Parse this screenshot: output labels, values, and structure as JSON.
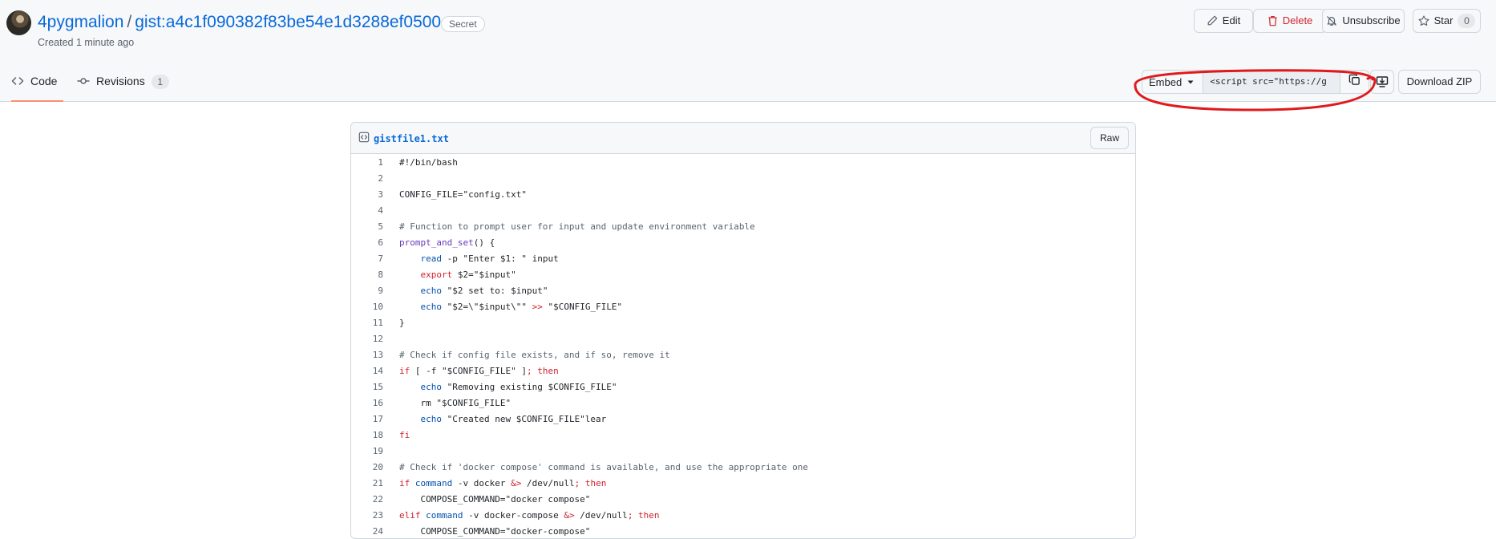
{
  "header": {
    "owner": "4pygmalion",
    "separator": "/",
    "gist_name": "gist:a4c1f090382f83be54e1d3288ef0500e",
    "visibility_badge": "Secret",
    "created": "Created 1 minute ago",
    "actions": {
      "edit": "Edit",
      "delete": "Delete",
      "unsubscribe": "Unsubscribe",
      "star": "Star",
      "star_count": "0"
    }
  },
  "tabs": [
    {
      "label": "Code",
      "active": true
    },
    {
      "label": "Revisions",
      "count": "1"
    }
  ],
  "toolbar": {
    "embed_label": "Embed",
    "embed_value": "<script src=\"https://g",
    "download_zip": "Download ZIP"
  },
  "file": {
    "name": "gistfile1.txt",
    "raw_label": "Raw"
  },
  "code_lines": [
    {
      "n": "1",
      "segs": [
        {
          "t": "#!/bin/bash"
        }
      ]
    },
    {
      "n": "2",
      "segs": [
        {
          "t": ""
        }
      ]
    },
    {
      "n": "3",
      "segs": [
        {
          "t": "CONFIG_FILE=\"config.txt\""
        }
      ]
    },
    {
      "n": "4",
      "segs": [
        {
          "t": ""
        }
      ]
    },
    {
      "n": "5",
      "segs": [
        {
          "t": "# Function to prompt user for input and update environment variable",
          "c": "cm"
        }
      ]
    },
    {
      "n": "6",
      "segs": [
        {
          "t": "prompt_and_set",
          "c": "fn"
        },
        {
          "t": "() {"
        }
      ]
    },
    {
      "n": "7",
      "segs": [
        {
          "t": "    "
        },
        {
          "t": "read",
          "c": "bi"
        },
        {
          "t": " -p \"Enter $1: \" input"
        }
      ]
    },
    {
      "n": "8",
      "segs": [
        {
          "t": "    "
        },
        {
          "t": "export",
          "c": "kw"
        },
        {
          "t": " $2=\"$input\""
        }
      ]
    },
    {
      "n": "9",
      "segs": [
        {
          "t": "    "
        },
        {
          "t": "echo",
          "c": "bi"
        },
        {
          "t": " \"$2 set to: $input\""
        }
      ]
    },
    {
      "n": "10",
      "segs": [
        {
          "t": "    "
        },
        {
          "t": "echo",
          "c": "bi"
        },
        {
          "t": " \"$2=\\\"$input\\\"\" "
        },
        {
          "t": ">>",
          "c": "kw"
        },
        {
          "t": " \"$CONFIG_FILE\""
        }
      ]
    },
    {
      "n": "11",
      "segs": [
        {
          "t": "}"
        }
      ]
    },
    {
      "n": "12",
      "segs": [
        {
          "t": ""
        }
      ]
    },
    {
      "n": "13",
      "segs": [
        {
          "t": "# Check if config file exists, and if so, remove it",
          "c": "cm"
        }
      ]
    },
    {
      "n": "14",
      "segs": [
        {
          "t": "if",
          "c": "kw"
        },
        {
          "t": " [ -f \"$CONFIG_FILE\" ]"
        },
        {
          "t": "; then",
          "c": "kw"
        }
      ]
    },
    {
      "n": "15",
      "segs": [
        {
          "t": "    "
        },
        {
          "t": "echo",
          "c": "bi"
        },
        {
          "t": " \"Removing existing $CONFIG_FILE\""
        }
      ]
    },
    {
      "n": "16",
      "segs": [
        {
          "t": "    rm \"$CONFIG_FILE\""
        }
      ]
    },
    {
      "n": "17",
      "segs": [
        {
          "t": "    "
        },
        {
          "t": "echo",
          "c": "bi"
        },
        {
          "t": " \"Created new $CONFIG_FILE\"lear"
        }
      ]
    },
    {
      "n": "18",
      "segs": [
        {
          "t": "fi",
          "c": "kw"
        }
      ]
    },
    {
      "n": "19",
      "segs": [
        {
          "t": ""
        }
      ]
    },
    {
      "n": "20",
      "segs": [
        {
          "t": "# Check if 'docker compose' command is available, and use the appropriate one",
          "c": "cm"
        }
      ]
    },
    {
      "n": "21",
      "segs": [
        {
          "t": "if",
          "c": "kw"
        },
        {
          "t": " "
        },
        {
          "t": "command",
          "c": "bi"
        },
        {
          "t": " -v docker "
        },
        {
          "t": "&>",
          "c": "kw"
        },
        {
          "t": " /dev/null"
        },
        {
          "t": "; then",
          "c": "kw"
        }
      ]
    },
    {
      "n": "22",
      "segs": [
        {
          "t": "    COMPOSE_COMMAND=\"docker compose\""
        }
      ]
    },
    {
      "n": "23",
      "segs": [
        {
          "t": "elif",
          "c": "kw"
        },
        {
          "t": " "
        },
        {
          "t": "command",
          "c": "bi"
        },
        {
          "t": " -v docker-compose "
        },
        {
          "t": "&>",
          "c": "kw"
        },
        {
          "t": " /dev/null"
        },
        {
          "t": "; then",
          "c": "kw"
        }
      ]
    },
    {
      "n": "24",
      "segs": [
        {
          "t": "    COMPOSE_COMMAND=\"docker-compose\""
        }
      ]
    }
  ],
  "colors": {
    "link": "#0969da",
    "danger": "#d1242f",
    "tab_underline": "#fd8c73",
    "annotation": "#e0191c"
  }
}
